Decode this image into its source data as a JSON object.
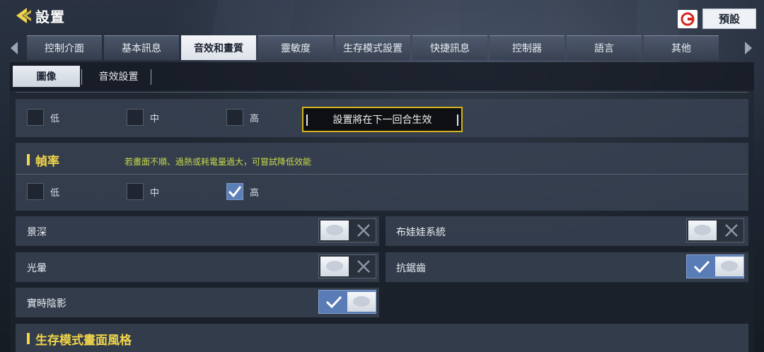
{
  "header": {
    "title": "設置",
    "preset_label": "預設"
  },
  "tabs": [
    {
      "label": "控制介面"
    },
    {
      "label": "基本訊息"
    },
    {
      "label": "音效和畫質"
    },
    {
      "label": "靈敏度"
    },
    {
      "label": "生存模式設置"
    },
    {
      "label": "快捷訊息"
    },
    {
      "label": "控制器"
    },
    {
      "label": "語言"
    },
    {
      "label": "其他"
    }
  ],
  "active_tab": "音效和畫質",
  "subtabs": [
    {
      "label": "圖像"
    },
    {
      "label": "音效設置"
    }
  ],
  "quality": {
    "options": [
      "低",
      "中",
      "高"
    ],
    "notice": "設置將在下一回合生效"
  },
  "framerate": {
    "title": "幀率",
    "hint": "若畫面不順、過熱或耗電量過大，可嘗試降低效能",
    "options": [
      "低",
      "中",
      "高"
    ],
    "selected": "高"
  },
  "toggles": {
    "depth_of_field": {
      "label": "景深",
      "state": "off"
    },
    "ragdoll": {
      "label": "布娃娃系統",
      "state": "off"
    },
    "bloom": {
      "label": "光暈",
      "state": "off"
    },
    "anti_aliasing": {
      "label": "抗鋸齒",
      "state": "on"
    },
    "realtime_shadow": {
      "label": "實時陰影",
      "state": "on"
    }
  },
  "survival_style": {
    "title": "生存模式畫面風格"
  },
  "colors": {
    "accent_yellow": "#f1d54a",
    "toggle_on": "#5a7cb6",
    "notice_border": "#d4b31c"
  },
  "icons": {
    "back": "back-arrow-icon",
    "brand": "garena-logo-icon",
    "check": "check-icon",
    "cross": "close-icon"
  }
}
